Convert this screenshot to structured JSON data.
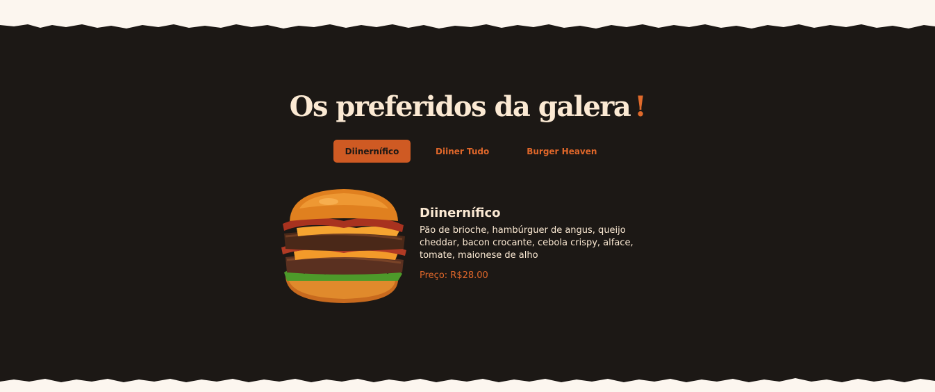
{
  "section": {
    "title": "Os preferidos da galera",
    "title_mark": "!"
  },
  "tabs": [
    {
      "label": "Diinernífico",
      "active": true
    },
    {
      "label": "Diiner Tudo",
      "active": false
    },
    {
      "label": "Burger Heaven",
      "active": false
    }
  ],
  "product": {
    "name": "Diinernífico",
    "description": "Pão de brioche, hambúrguer de angus, queijo cheddar, bacon crocante, cebola crispy, alface, tomate, maionese de alho",
    "price": "Preço: R$28.00",
    "image_icon": "burger-image"
  },
  "colors": {
    "background_dark": "#1c1815",
    "page_light": "#fcf6ef",
    "accent": "#cf5a23",
    "text_light": "#fbe9d3"
  }
}
